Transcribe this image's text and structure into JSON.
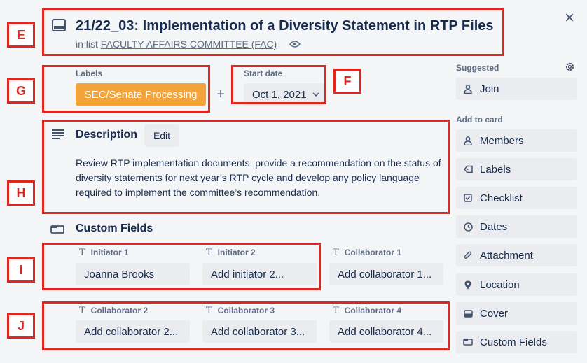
{
  "header": {
    "title": "21/22_03: Implementation of a Diversity Statement in RTP Files",
    "in_list_prefix": "in list",
    "list_name": "FACULTY AFFAIRS COMMITTEE (FAC)"
  },
  "labels": {
    "heading": "Labels",
    "label_text": "SEC/Senate Processing",
    "label_color": "#f2a33a",
    "add_symbol": "+"
  },
  "start_date": {
    "heading": "Start date",
    "value": "Oct 1, 2021"
  },
  "description": {
    "heading": "Description",
    "edit_label": "Edit",
    "text": "Review RTP implementation documents, provide a recommendation on the status of diversity statements for next year’s RTP cycle and develop any policy language required to implement the committee’s recommendation."
  },
  "custom_fields": {
    "heading": "Custom Fields",
    "fields": [
      {
        "label": "Initiator 1",
        "value": "Joanna Brooks"
      },
      {
        "label": "Initiator 2",
        "value": "Add initiator 2..."
      },
      {
        "label": "Collaborator 1",
        "value": "Add collaborator 1..."
      },
      {
        "label": "Collaborator 2",
        "value": "Add collaborator 2..."
      },
      {
        "label": "Collaborator 3",
        "value": "Add collaborator 3..."
      },
      {
        "label": "Collaborator 4",
        "value": "Add collaborator 4..."
      }
    ],
    "type_glyph": "T"
  },
  "sidebar": {
    "suggested_heading": "Suggested",
    "join_label": "Join",
    "add_to_card_heading": "Add to card",
    "items": [
      {
        "label": "Members",
        "icon": "person-icon"
      },
      {
        "label": "Labels",
        "icon": "tag-icon"
      },
      {
        "label": "Checklist",
        "icon": "checkbox-icon"
      },
      {
        "label": "Dates",
        "icon": "clock-icon"
      },
      {
        "label": "Attachment",
        "icon": "paperclip-icon"
      },
      {
        "label": "Location",
        "icon": "location-pin-icon"
      },
      {
        "label": "Cover",
        "icon": "cover-icon"
      },
      {
        "label": "Custom Fields",
        "icon": "custom-fields-icon"
      }
    ]
  },
  "annotations": {
    "E": "E",
    "F": "F",
    "G": "G",
    "H": "H",
    "I": "I",
    "J": "J",
    "color": "#e0271f"
  },
  "close_symbol": "×"
}
